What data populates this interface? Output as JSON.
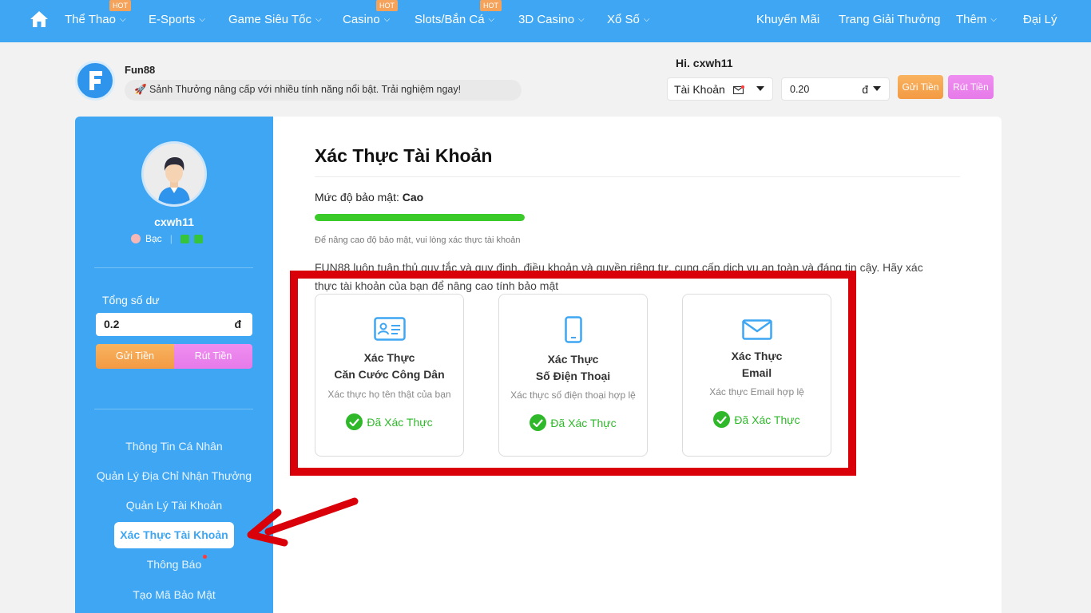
{
  "nav": {
    "items": [
      {
        "label": "Thể Thao",
        "hot": "HOT",
        "chevron": true
      },
      {
        "label": "E-Sports",
        "hot": "",
        "chevron": true
      },
      {
        "label": "Game Siêu Tốc",
        "hot": "",
        "chevron": true
      },
      {
        "label": "Casino",
        "hot": "HOT",
        "chevron": true
      },
      {
        "label": "Slots/Bắn Cá",
        "hot": "HOT",
        "chevron": true
      },
      {
        "label": "3D Casino",
        "hot": "",
        "chevron": true
      },
      {
        "label": "Xổ Số",
        "hot": "",
        "chevron": true
      }
    ],
    "right": [
      {
        "label": "Khuyến Mãi"
      },
      {
        "label": "Trang Giải Thưởng"
      },
      {
        "label": "Thêm"
      },
      {
        "label": "Đại Lý"
      }
    ]
  },
  "header": {
    "brand": "Fun88",
    "marquee": "🚀 Sảnh Thưởng nâng cấp với nhiều tính năng nổi bật. Trải nghiệm ngay!",
    "greeting": "Hi.  cxwh11",
    "account_label": "Tài Khoản",
    "balance_value": "0.20",
    "currency": "đ",
    "deposit": "Gửi Tiền",
    "withdraw": "Rút Tiền"
  },
  "sidebar": {
    "username": "cxwh11",
    "rank": "Bạc",
    "balance_label": "Tổng số dư",
    "balance_value": "0.2",
    "currency": "đ",
    "deposit": "Gửi Tiền",
    "withdraw": "Rút Tiền",
    "menu": [
      "Thông Tin Cá Nhân",
      "Quản Lý Địa Chỉ Nhận Thưởng",
      "Quản Lý Tài Khoản",
      "Xác Thực Tài Khoản",
      "Thông Báo",
      "Tạo Mã Bảo Mật"
    ]
  },
  "main": {
    "title": "Xác Thực Tài Khoản",
    "security_prefix": "Mức độ bảo mật: ",
    "security_level": "Cao",
    "security_progress": 1.0,
    "hint": "Để nâng cao độ bảo mật, vui lòng xác thực tài khoản",
    "policy": "FUN88 luôn tuân thủ quy tắc và quy định, điều khoản và quyền riêng tư, cung cấp dịch vụ an toàn và đáng tin cậy. Hãy xác thực tài khoản của bạn để nâng cao tính bảo mật",
    "cards": [
      {
        "icon": "id-card-icon",
        "line1": "Xác Thực",
        "line2": "Căn Cước Công Dân",
        "desc": "Xác thực họ tên thật của bạn",
        "status": "Đã Xác Thực"
      },
      {
        "icon": "phone-icon",
        "line1": "Xác Thực",
        "line2": "Số Điện Thoại",
        "desc": "Xác thực số điện thoại hợp lệ",
        "status": "Đã Xác Thực"
      },
      {
        "icon": "email-icon",
        "line1": "Xác Thực",
        "line2": "Email",
        "desc": "Xác thực Email hợp lệ",
        "status": "Đã Xác Thực"
      }
    ]
  },
  "colors": {
    "nav_blue": "#3ea6f2",
    "verified_green": "#2fb82a",
    "annotation_red": "#d9000a"
  }
}
